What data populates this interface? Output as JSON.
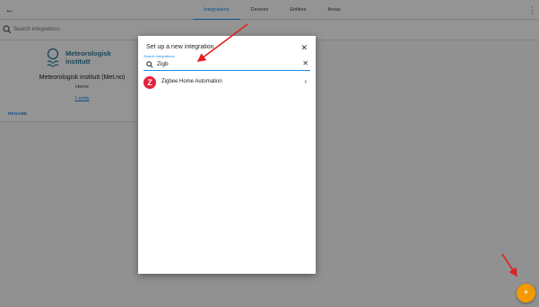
{
  "topbar": {
    "tabs": [
      {
        "label": "Integrations",
        "active": true
      },
      {
        "label": "Devices"
      },
      {
        "label": "Entities"
      },
      {
        "label": "Areas"
      }
    ]
  },
  "search": {
    "placeholder": "Search integrations"
  },
  "card": {
    "logo_line1": "Meteorologisk",
    "logo_line2": "institutt",
    "title": "Meteorologisk institutt (Met.no)",
    "subtitle": "Home",
    "link": "1 entity",
    "rename": "RENAME"
  },
  "dialog": {
    "title": "Set up a new integration",
    "search_label": "Search integrations",
    "search_value": "Zigb",
    "results": [
      {
        "name": "Zigbee Home Automation",
        "logo_letter": "Z",
        "logo_color": "#e5213b"
      }
    ]
  },
  "fab": {
    "icon": "+",
    "color": "#f29a00"
  },
  "annotation_color": "#e02020",
  "accent_color": "#1e88e5"
}
